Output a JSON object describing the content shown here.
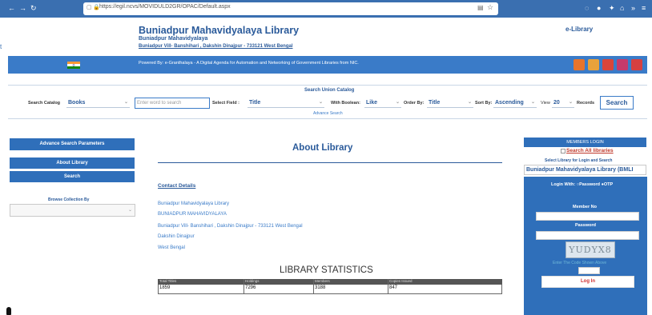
{
  "browser": {
    "url": "https://egil.ncvs/MOVIDULD2GR/OPAC/Default.aspx",
    "back_icon": "arrow-left-icon",
    "forward_icon": "arrow-right-icon",
    "reload_icon": "reload-icon"
  },
  "header": {
    "title": "Buniadpur Mahavidyalaya Library",
    "subtitle": "Buniadpur Mahavidyalaya",
    "address": "Buniadpur Vill- Banshihari , Dakshin Dinajpur - 733121 West Bengal",
    "elibrary": "e-Library",
    "powered_by": "Powered By: e-Granthalaya - A Digital Agenda for Automation and Networking of Government Libraries from NIC.",
    "edge_mark": "t"
  },
  "search": {
    "title": "Search Union Catalog",
    "catalog_label": "Search Catalog",
    "catalog_value": "Books",
    "word_placeholder": "Enter word to search",
    "field_label": "Select Field :",
    "field_value": "Title",
    "boolean_label": "With Boolean:",
    "boolean_value": "Like",
    "order_label": "Order By:",
    "order_value": "Title",
    "sort_label": "Sort By:",
    "sort_value": "Ascending",
    "view_label": "View",
    "view_value": "20",
    "records_label": "Records",
    "button": "Search",
    "advance_link": "Advance Search"
  },
  "sidebar": {
    "advance_params": "Advance Search Parameters",
    "about": "About Library",
    "search": "Search",
    "browse_label": "Browse Collection By"
  },
  "main": {
    "title": "About Library",
    "contact_heading": "Contact Details",
    "contact_lines": [
      "Buniadpur Mahavidyalaya Library",
      "BUNIADPUR MAHAVIDYALAYA",
      "Buniadpur Vill- Banshihari , Dakshin Dinajpur - 733121 West Bengal",
      "Dakshin Dinajpur",
      "West Bengal"
    ],
    "stats_title": "LIBRARY STATISTICS",
    "stats": {
      "headers": [
        "Total Titles",
        "Holdings",
        "Members",
        "Copies Issued"
      ],
      "values": [
        "1859",
        "7296",
        "3188",
        "847"
      ]
    }
  },
  "login": {
    "members_login": "MEMBERS LOGIN",
    "search_all": "Search All libraries",
    "select_lib_label": "Select Library for Login and Search",
    "library_value": "Buniadpur Mahavidyalaya Library (BMLI",
    "login_with": "Login With:",
    "opt_password": "Password",
    "opt_otp": "OTP",
    "member_no_label": "Member No",
    "password_label": "Password",
    "captcha_text": "YUDYX8",
    "captcha_label": "Enter The Code Shown Above",
    "login_button": "Log In"
  },
  "colors": {
    "brand_blue": "#2f6fba",
    "header_text": "#2a5a9a",
    "alert_red": "#c0392b"
  }
}
